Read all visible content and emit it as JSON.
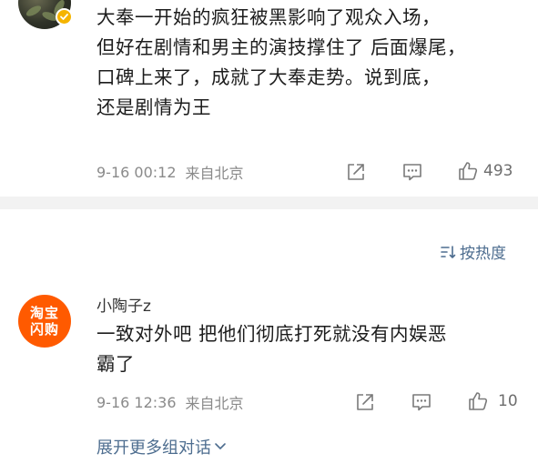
{
  "comment1": {
    "lines": [
      "大奉一开始的疯狂被黑影响了观众入场，",
      "但好在剧情和男主的演技撑住了 后面爆尾，",
      "口碑上来了，成就了大奉走势。说到底，",
      "还是剧情为王"
    ],
    "time": "9-16 00:12",
    "location": "来自北京",
    "likes": "493",
    "verified_badge_color": "#f5b400"
  },
  "sort": {
    "label": "按热度"
  },
  "comment2": {
    "username": "小陶子z",
    "avatar_text_line1": "淘宝",
    "avatar_text_line2": "闪购",
    "avatar_color": "#ff5a00",
    "lines": [
      "一致对外吧 把他们彻底打死就没有内娱恶",
      "霸了"
    ],
    "time": "9-16 12:36",
    "location": "来自北京",
    "likes": "10"
  },
  "expand": {
    "label": "展开更多组对话"
  },
  "icons": {
    "share": "share-icon",
    "comment": "comment-icon",
    "like": "thumbs-up-icon",
    "sort": "sort-icon",
    "expand": "chevron-down-icon",
    "verified": "verified-badge-icon"
  },
  "colors": {
    "link": "#4d6d8f",
    "meta": "#8a8a8a",
    "divider": "#f2f2f2"
  }
}
